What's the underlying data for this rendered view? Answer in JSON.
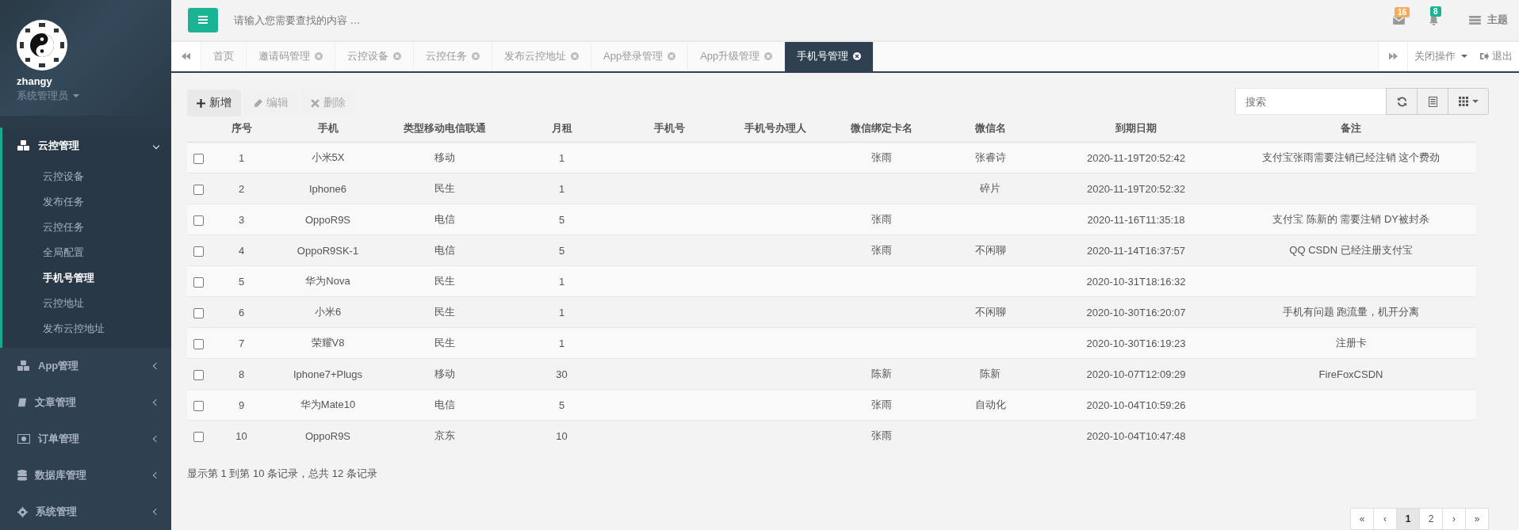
{
  "sidebar": {
    "user": {
      "name": "zhangy",
      "role": "系统管理员"
    },
    "menu": [
      {
        "label": "云控管理",
        "expanded": true,
        "children": [
          {
            "label": "云控设备",
            "selected": false
          },
          {
            "label": "发布任务",
            "selected": false
          },
          {
            "label": "云控任务",
            "selected": false
          },
          {
            "label": "全局配置",
            "selected": false
          },
          {
            "label": "手机号管理",
            "selected": true
          },
          {
            "label": "云控地址",
            "selected": false
          },
          {
            "label": "发布云控地址",
            "selected": false
          }
        ]
      },
      {
        "label": "App管理",
        "expanded": false
      },
      {
        "label": "文章管理",
        "expanded": false
      },
      {
        "label": "订单管理",
        "expanded": false
      },
      {
        "label": "数据库管理",
        "expanded": false
      },
      {
        "label": "系统管理",
        "expanded": false
      }
    ]
  },
  "topbar": {
    "search": {
      "placeholder": "请输入您需要查找的内容 …"
    },
    "mail_badge": "16",
    "bell_badge": "8",
    "theme": "主题"
  },
  "tabs": [
    {
      "label": "首页",
      "closable": false,
      "selected": false
    },
    {
      "label": "邀请码管理",
      "closable": true,
      "selected": false
    },
    {
      "label": "云控设备",
      "closable": true,
      "selected": false
    },
    {
      "label": "云控任务",
      "closable": true,
      "selected": false
    },
    {
      "label": "发布云控地址",
      "closable": true,
      "selected": false
    },
    {
      "label": "App登录管理",
      "closable": true,
      "selected": false
    },
    {
      "label": "App升级管理",
      "closable": true,
      "selected": false
    },
    {
      "label": "手机号管理",
      "closable": true,
      "selected": true
    }
  ],
  "tab_actions": {
    "close_menu": "关闭操作",
    "logout": "退出"
  },
  "toolbar": [
    {
      "label": "新增",
      "disabled": false
    },
    {
      "label": "编辑",
      "disabled": true
    },
    {
      "label": "删除",
      "disabled": true
    }
  ],
  "table_search": {
    "placeholder": "搜索"
  },
  "table": {
    "columns": [
      {
        "label": "序号"
      },
      {
        "label": "手机"
      },
      {
        "label": "类型移动电信联通"
      },
      {
        "label": "月租"
      },
      {
        "label": "手机号"
      },
      {
        "label": "手机号办理人"
      },
      {
        "label": "微信绑定卡名"
      },
      {
        "label": "微信名"
      },
      {
        "label": "到期日期"
      },
      {
        "label": "备注"
      }
    ],
    "rows": [
      {
        "checked": false,
        "no": "1",
        "model": "小米5X",
        "carrier": "移动",
        "rent": "1",
        "card": "张雨",
        "wechat": "张睿诗",
        "expiry": "2020-11-19T20:52:42",
        "note": "支付宝张雨需要注销已经注销 这个费劲"
      },
      {
        "checked": false,
        "no": "2",
        "model": "Iphone6",
        "carrier": "民生",
        "rent": "1",
        "wechat": "碎片",
        "expiry": "2020-11-19T20:52:32"
      },
      {
        "checked": false,
        "no": "3",
        "model": "OppoR9S",
        "carrier": "电信",
        "rent": "5",
        "card": "张雨",
        "expiry": "2020-11-16T11:35:18",
        "note": "支付宝 陈新的 需要注销 DY被封杀"
      },
      {
        "checked": false,
        "no": "4",
        "model": "OppoR9SK-1",
        "carrier": "电信",
        "rent": "5",
        "card": "张雨",
        "wechat": "不闲聊",
        "expiry": "2020-11-14T16:37:57",
        "note": "QQ CSDN 已经注册支付宝"
      },
      {
        "checked": false,
        "no": "5",
        "model": "华为Nova",
        "carrier": "民生",
        "rent": "1",
        "expiry": "2020-10-31T18:16:32"
      },
      {
        "checked": false,
        "no": "6",
        "model": "小米6",
        "carrier": "民生",
        "rent": "1",
        "wechat": "不闲聊",
        "expiry": "2020-10-30T16:20:07",
        "note": "手机有问题 跑流量，机开分离"
      },
      {
        "checked": false,
        "no": "7",
        "model": "荣耀V8",
        "carrier": "民生",
        "rent": "1",
        "expiry": "2020-10-30T16:19:23",
        "note": "注册卡"
      },
      {
        "checked": false,
        "no": "8",
        "model": "Iphone7+Plugs",
        "carrier": "移动",
        "rent": "30",
        "card": "陈新",
        "wechat": "陈新",
        "expiry": "2020-10-07T12:09:29",
        "note": "FireFoxCSDN"
      },
      {
        "checked": false,
        "no": "9",
        "model": "华为Mate10",
        "carrier": "电信",
        "rent": "5",
        "card": "张雨",
        "wechat": "自动化",
        "expiry": "2020-10-04T10:59:26"
      },
      {
        "checked": false,
        "no": "10",
        "model": "OppoR9S",
        "carrier": "京东",
        "rent": "10",
        "card": "张雨",
        "expiry": "2020-10-04T10:47:48"
      }
    ]
  },
  "pagination": {
    "info": "显示第 1 到第 10 条记录，总共 12 条记录",
    "pages": [
      {
        "label": "«",
        "selected": false
      },
      {
        "label": "‹",
        "selected": false
      },
      {
        "label": "1",
        "selected": true
      },
      {
        "label": "2",
        "selected": false
      },
      {
        "label": "›",
        "selected": false
      },
      {
        "label": "»",
        "selected": false
      }
    ]
  }
}
